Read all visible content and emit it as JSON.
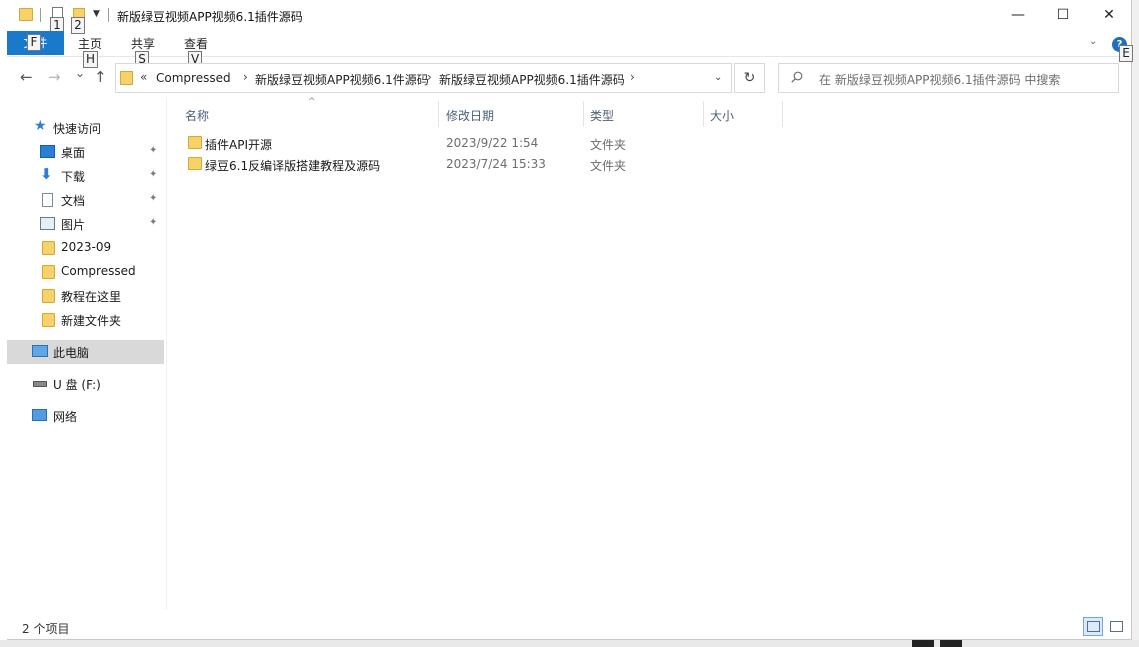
{
  "titlebar": {
    "title": "新版绿豆视频APP视频6.1插件源码",
    "keytips": [
      "1",
      "2"
    ],
    "minimize": "—",
    "maximize": "☐",
    "close": "✕"
  },
  "ribbon": {
    "tabs": [
      {
        "label": "文件",
        "keytip": "F"
      },
      {
        "label": "主页",
        "keytip": "H"
      },
      {
        "label": "共享",
        "keytip": "S"
      },
      {
        "label": "查看",
        "keytip": "V"
      }
    ],
    "help_keytip": "E",
    "help_icon": "?",
    "expand_icon": "chevron-down-icon"
  },
  "nav": {
    "back": "←",
    "forward": "→",
    "recent": "⌄",
    "up": "↑",
    "address": {
      "overflow": "«",
      "crumbs": [
        "Compressed",
        "新版绿豆视频APP视频6.1件源码",
        "新版绿豆视频APP视频6.1插件源码"
      ],
      "separator": "›",
      "dropdown": "⌄"
    },
    "refresh": "↻",
    "search_placeholder": "在 新版绿豆视频APP视频6.1插件源码 中搜索"
  },
  "sidebar": {
    "quick_access": "快速访问",
    "items": [
      {
        "label": "桌面",
        "icon": "desktop-icon",
        "pinned": true
      },
      {
        "label": "下载",
        "icon": "download-icon",
        "pinned": true
      },
      {
        "label": "文档",
        "icon": "document-icon",
        "pinned": true
      },
      {
        "label": "图片",
        "icon": "pictures-icon",
        "pinned": true
      },
      {
        "label": "2023-09",
        "icon": "folder-icon",
        "pinned": false
      },
      {
        "label": "Compressed",
        "icon": "folder-icon",
        "pinned": false
      },
      {
        "label": "教程在这里",
        "icon": "folder-icon",
        "pinned": false
      },
      {
        "label": "新建文件夹",
        "icon": "folder-icon",
        "pinned": false
      }
    ],
    "this_pc": "此电脑",
    "usb": "U 盘 (F:)",
    "network": "网络",
    "pin_glyph": "📌"
  },
  "filelist": {
    "columns": [
      "名称",
      "修改日期",
      "类型",
      "大小"
    ],
    "sort_glyph": "^",
    "rows": [
      {
        "name": "插件API开源",
        "date": "2023/9/22 1:54",
        "type": "文件夹",
        "size": ""
      },
      {
        "name": "绿豆6.1反编译版搭建教程及源码",
        "date": "2023/7/24 15:33",
        "type": "文件夹",
        "size": ""
      }
    ]
  },
  "status": {
    "count": "2 个项目",
    "views": [
      "details-view-icon",
      "large-icons-view-icon"
    ],
    "active_view": "details-view-icon"
  },
  "colors": {
    "file_tab": "#1979ca",
    "folder": "#f6d26b",
    "selection": "#d9d9d9",
    "header_text": "#4c607a"
  }
}
